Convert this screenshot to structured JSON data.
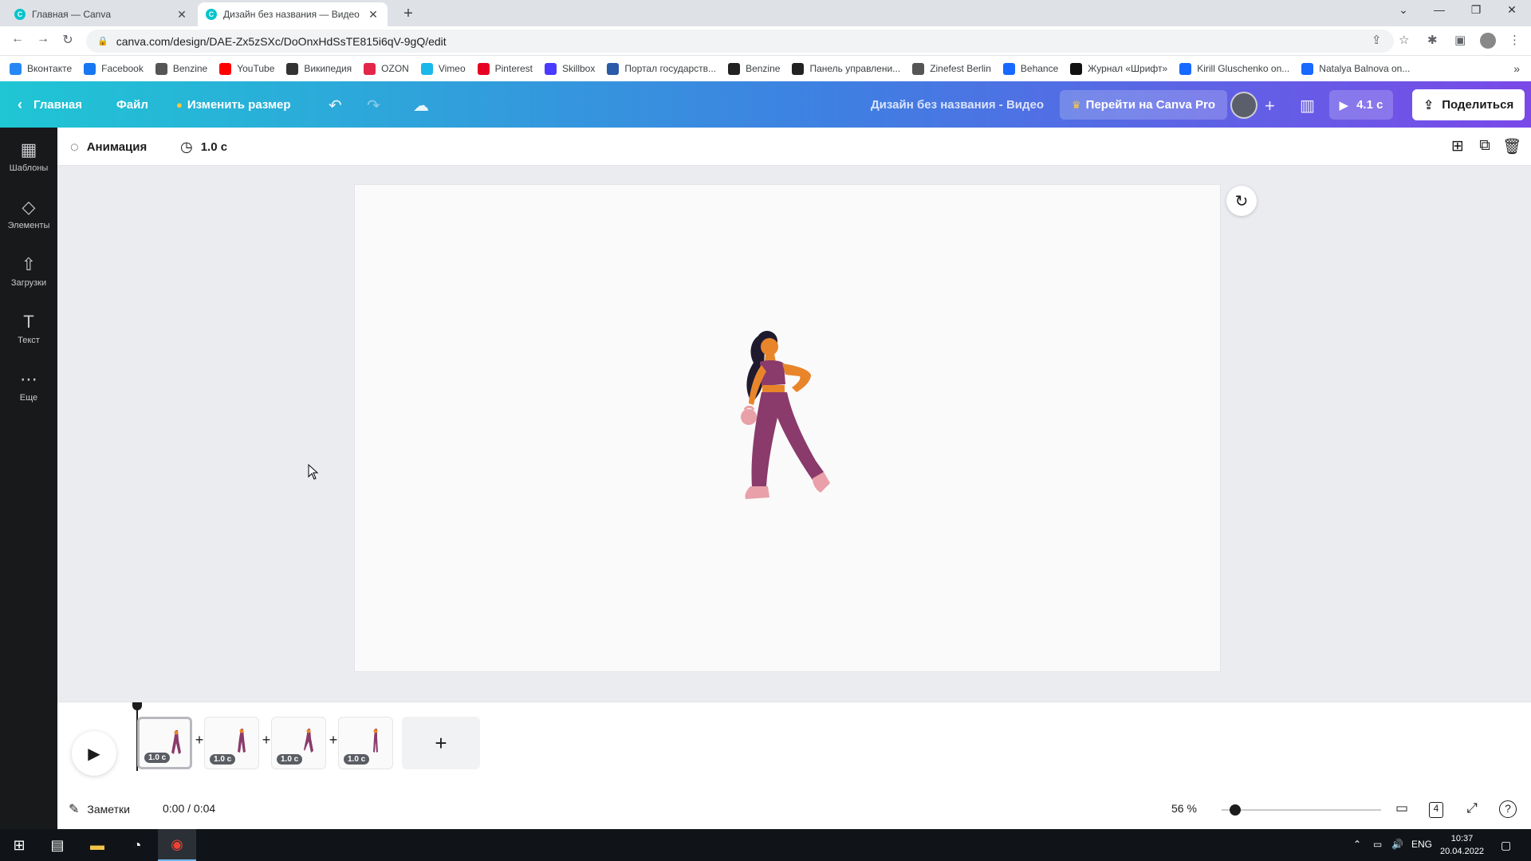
{
  "browser": {
    "tabs": [
      {
        "title": "Главная — Canva",
        "active": false
      },
      {
        "title": "Дизайн без названия — Видео",
        "active": true
      }
    ],
    "url": "canva.com/design/DAE-Zx5zSXc/DoOnxHdSsTE815i6qV-9gQ/edit",
    "bookmarks": [
      {
        "label": "Вконтакте",
        "icon": "vk-icon",
        "color": "#2787f5"
      },
      {
        "label": "Facebook",
        "icon": "facebook-icon",
        "color": "#1877f2"
      },
      {
        "label": "Benzine",
        "icon": "benzine-icon",
        "color": "#555555"
      },
      {
        "label": "YouTube",
        "icon": "youtube-icon",
        "color": "#ff0000"
      },
      {
        "label": "Википедия",
        "icon": "wikipedia-icon",
        "color": "#333333"
      },
      {
        "label": "OZON",
        "icon": "ozon-icon",
        "color": "#e4264a"
      },
      {
        "label": "Vimeo",
        "icon": "vimeo-icon",
        "color": "#1ab7ea"
      },
      {
        "label": "Pinterest",
        "icon": "pinterest-icon",
        "color": "#e60023"
      },
      {
        "label": "Skillbox",
        "icon": "skillbox-icon",
        "color": "#4a3aff"
      },
      {
        "label": "Портал государств...",
        "icon": "russia-flag-icon",
        "color": "#2b5aa8"
      },
      {
        "label": "Benzine",
        "icon": "wix-icon",
        "color": "#222222"
      },
      {
        "label": "Панель управлени...",
        "icon": "wix-icon",
        "color": "#222222"
      },
      {
        "label": "Zinefest Berlin",
        "icon": "globe-icon",
        "color": "#555555"
      },
      {
        "label": "Behance",
        "icon": "behance-icon",
        "color": "#1769ff"
      },
      {
        "label": "Журнал «Шрифт»",
        "icon": "shrift-icon",
        "color": "#111111"
      },
      {
        "label": "Kirill Gluschenko on...",
        "icon": "behance-icon",
        "color": "#1769ff"
      },
      {
        "label": "Natalya Balnova on...",
        "icon": "behance-icon",
        "color": "#1769ff"
      }
    ]
  },
  "header": {
    "home_label": "Главная",
    "file_label": "Файл",
    "resize_label": "Изменить размер",
    "design_title": "Дизайн без названия - Видео",
    "pro_label": "Перейти на Canva Pro",
    "play_duration": "4.1 с",
    "share_label": "Поделиться"
  },
  "sidebar": {
    "items": [
      {
        "label": "Шаблоны",
        "icon": "templates-icon"
      },
      {
        "label": "Элементы",
        "icon": "elements-icon"
      },
      {
        "label": "Загрузки",
        "icon": "uploads-icon"
      },
      {
        "label": "Текст",
        "icon": "text-icon"
      },
      {
        "label": "Еще",
        "icon": "more-icon"
      }
    ]
  },
  "context_bar": {
    "animation_label": "Анимация",
    "duration_label": "1.0 с"
  },
  "timeline": {
    "clips": [
      {
        "duration": "1.0 с",
        "selected": true
      },
      {
        "duration": "1.0 с",
        "selected": false
      },
      {
        "duration": "1.0 с",
        "selected": false
      },
      {
        "duration": "1.0 с",
        "selected": false
      }
    ],
    "notes_label": "Заметки",
    "time": "0:00 / 0:04",
    "zoom": "56 %",
    "pages_count": "4"
  },
  "taskbar": {
    "lang": "ENG",
    "time": "10:37",
    "date": "20.04.2022"
  },
  "colors": {
    "accent": "#8b3dff",
    "header_gradient_start": "#1fc6d4",
    "header_gradient_end": "#7a49e8",
    "figure_skin": "#e8852b",
    "figure_clothes": "#8a3a6b"
  }
}
